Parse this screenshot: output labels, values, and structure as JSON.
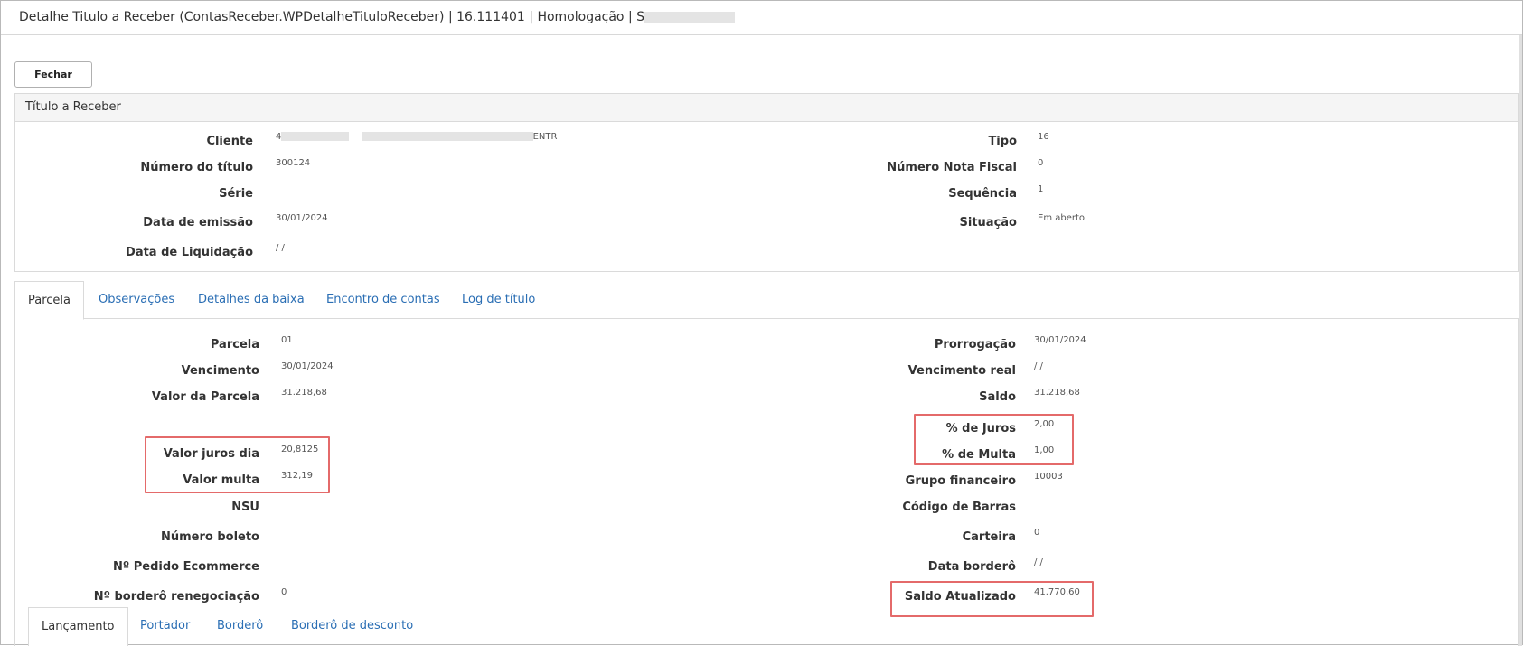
{
  "window": {
    "title": "Detalhe Titulo a Receber (ContasReceber.WPDetalheTituloReceber) | 16.111401 | Homologação | S"
  },
  "toolbar": {
    "close_label": "Fechar"
  },
  "titulo": {
    "header": "Título a Receber",
    "left": {
      "cliente_label": "Cliente",
      "cliente_value_start": "4",
      "cliente_value_end": "ENTR",
      "numero_label": "Número do título",
      "numero_value": "300124",
      "serie_label": "Série",
      "serie_value": "",
      "emissao_label": "Data de emissão",
      "emissao_value": "30/01/2024",
      "liquidacao_label": "Data de Liquidação",
      "liquidacao_value": "/ /"
    },
    "right": {
      "tipo_label": "Tipo",
      "tipo_value": "16",
      "nf_label": "Número Nota Fiscal",
      "nf_value": "0",
      "sequencia_label": "Sequência",
      "sequencia_value": "1",
      "situacao_label": "Situação",
      "situacao_value": "Em aberto"
    }
  },
  "tabs": [
    "Parcela",
    "Observações",
    "Detalhes da baixa",
    "Encontro de contas",
    "Log de título"
  ],
  "parcela": {
    "left": {
      "parcela_label": "Parcela",
      "parcela_value": "01",
      "vencimento_label": "Vencimento",
      "vencimento_value": "30/01/2024",
      "valor_label": "Valor da Parcela",
      "valor_value": "31.218,68",
      "juros_dia_label": "Valor juros dia",
      "juros_dia_value": "20,8125",
      "multa_label": "Valor multa",
      "multa_value": "312,19",
      "nsu_label": "NSU",
      "nsu_value": "",
      "boleto_label": "Número boleto",
      "boleto_value": "",
      "pedido_label": "Nº Pedido Ecommerce",
      "pedido_value": "",
      "bordero_reneg_label": "Nº borderô renegociação",
      "bordero_reneg_value": "0"
    },
    "right": {
      "prorrogacao_label": "Prorrogação",
      "prorrogacao_value": "30/01/2024",
      "venc_real_label": "Vencimento real",
      "venc_real_value": "/ /",
      "saldo_label": "Saldo",
      "saldo_value": "31.218,68",
      "pct_juros_label": "% de Juros",
      "pct_juros_value": "2,00",
      "pct_multa_label": "% de Multa",
      "pct_multa_value": "1,00",
      "grupo_label": "Grupo financeiro",
      "grupo_value": "10003",
      "barras_label": "Código de Barras",
      "barras_value": "",
      "carteira_label": "Carteira",
      "carteira_value": "0",
      "data_bordero_label": "Data borderô",
      "data_bordero_value": "/ /",
      "saldo_atual_label": "Saldo Atualizado",
      "saldo_atual_value": "41.770,60"
    }
  },
  "subtabs": [
    "Lançamento",
    "Portador",
    "Borderô",
    "Borderô de desconto"
  ],
  "colors": {
    "link": "#2a6eb4",
    "highlight": "#e46a6a"
  }
}
